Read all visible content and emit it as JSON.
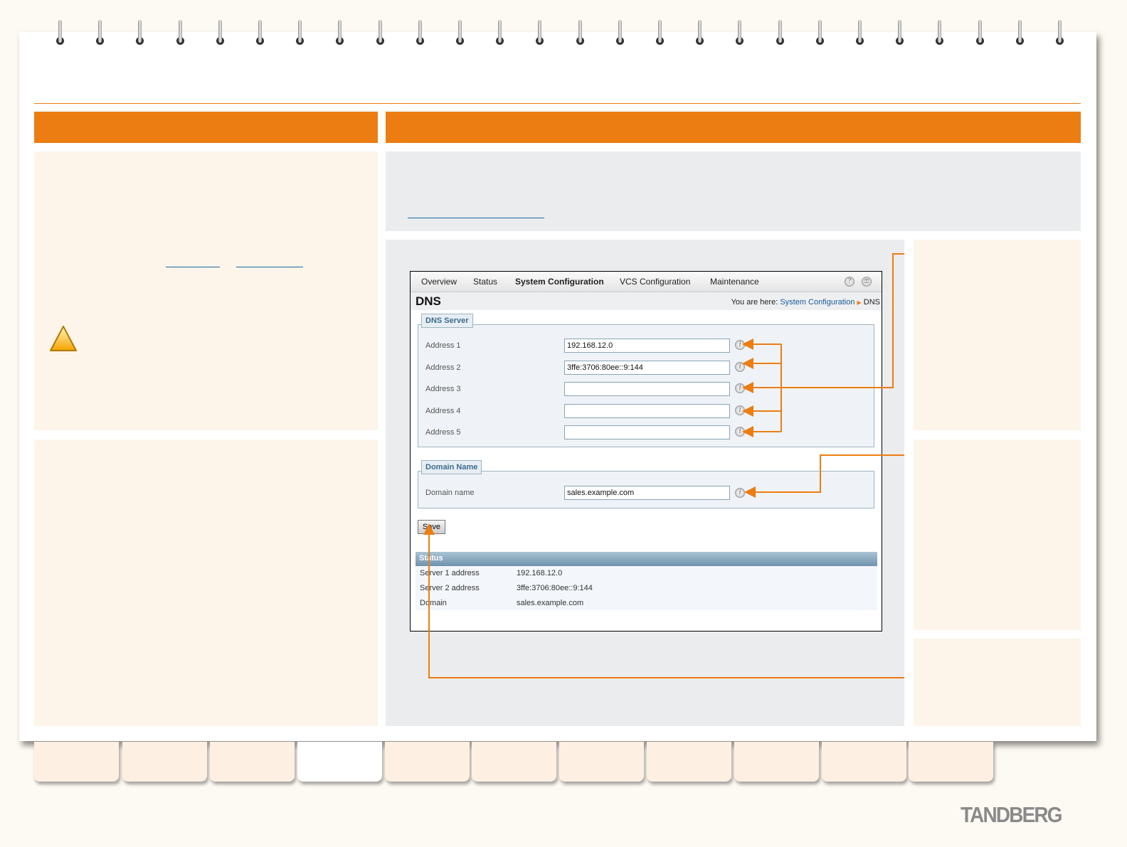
{
  "nav": {
    "items": [
      "Overview",
      "Status",
      "System Configuration",
      "VCS Configuration",
      "Maintenance"
    ],
    "active": "System Configuration",
    "help_icon": "question-icon",
    "logout_icon": "key-icon"
  },
  "page": {
    "title": "DNS",
    "breadcrumb_prefix": "You are here:",
    "breadcrumb_link": "System Configuration",
    "breadcrumb_current": "DNS"
  },
  "dns_server": {
    "legend": "DNS Server",
    "rows": [
      {
        "label": "Address 1",
        "value": "192.168.12.0"
      },
      {
        "label": "Address 2",
        "value": "3ffe:3706:80ee::9:144"
      },
      {
        "label": "Address 3",
        "value": ""
      },
      {
        "label": "Address 4",
        "value": ""
      },
      {
        "label": "Address 5",
        "value": ""
      }
    ]
  },
  "domain": {
    "legend": "Domain Name",
    "label": "Domain name",
    "value": "sales.example.com"
  },
  "save_label": "Save",
  "status": {
    "title": "Status",
    "rows": [
      {
        "label": "Server 1 address",
        "value": "192.168.12.0"
      },
      {
        "label": "Server 2 address",
        "value": "3ffe:3706:80ee::9:144"
      },
      {
        "label": "Domain",
        "value": "sales.example.com"
      }
    ]
  },
  "brand": "TANDBERG",
  "colors": {
    "accent": "#ec7d12",
    "cream": "#fdf4ea",
    "grey": "#ebecee"
  }
}
